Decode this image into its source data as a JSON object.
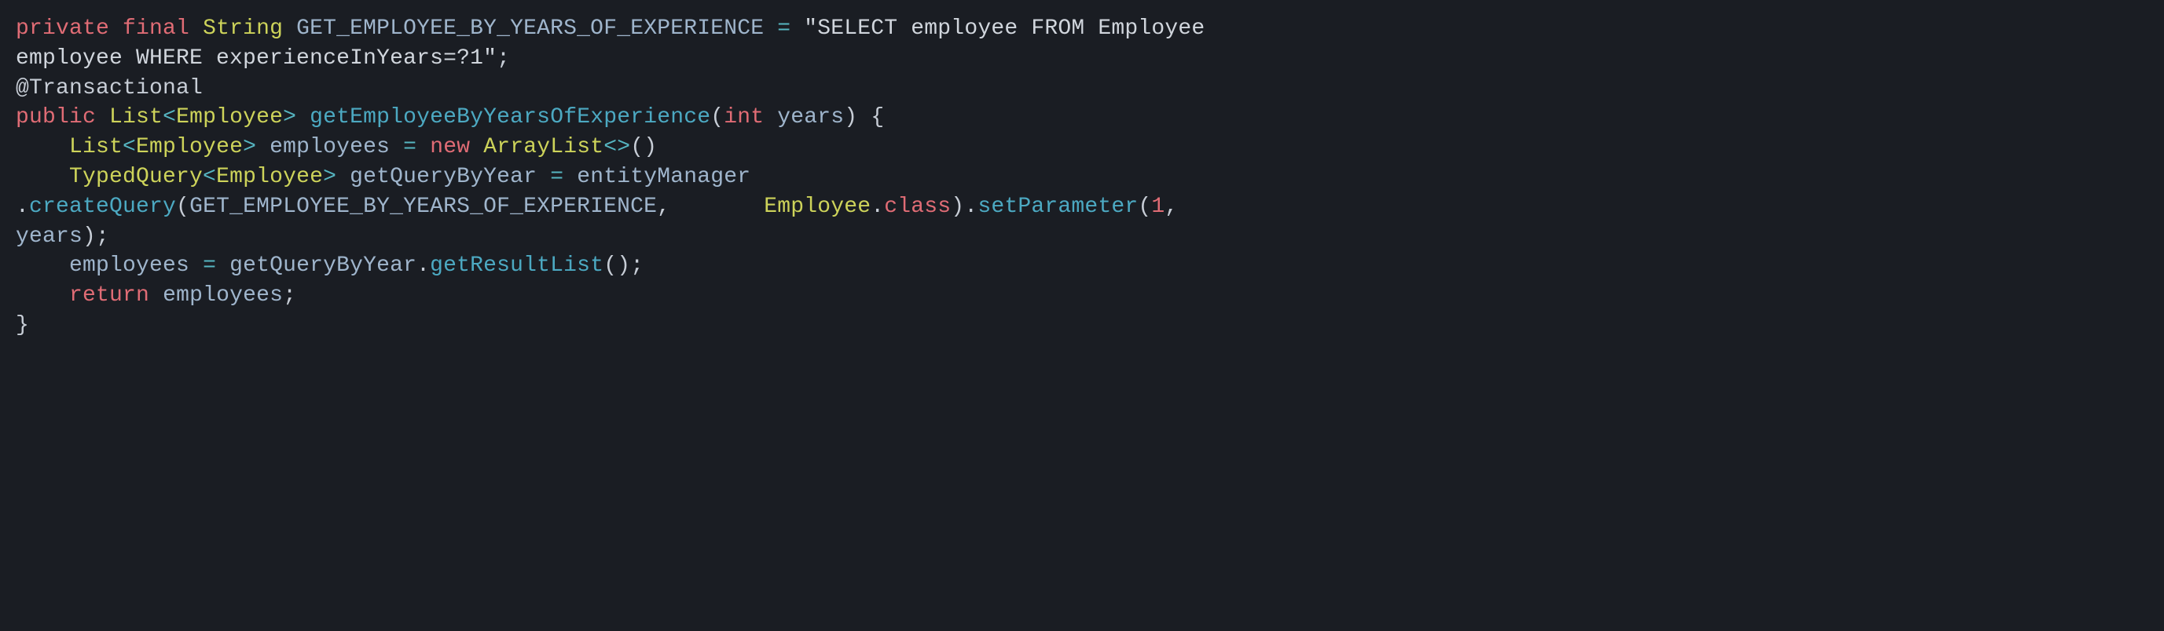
{
  "code": {
    "kw_private": "private",
    "kw_final": "final",
    "kw_public": "public",
    "kw_new": "new",
    "kw_int": "int",
    "kw_return": "return",
    "kw_class": "class",
    "type_String": "String",
    "type_List": "List",
    "type_Employee": "Employee",
    "type_ArrayList": "ArrayList",
    "type_TypedQuery": "TypedQuery",
    "const_name": "GET_EMPLOYEE_BY_YEARS_OF_EXPERIENCE",
    "sql_part1": "\"SELECT employee FROM Employee ",
    "sql_part2": "employee WHERE experienceInYears=?1\"",
    "annotation": "@Transactional",
    "method_name": "getEmployeeByYearsOfExperience",
    "param_name": "years",
    "var_employees": "employees",
    "var_getQueryByYear": "getQueryByYear",
    "var_entityManager": "entityManager",
    "m_createQuery": "createQuery",
    "m_setParameter": "setParameter",
    "m_getResultList": "getResultList",
    "num_1": "1",
    "op_eq": "=",
    "op_lt": "<",
    "op_gt": ">",
    "p_semi": ";",
    "p_dot": ".",
    "p_comma": ",",
    "p_lparen": "(",
    "p_rparen": ")",
    "p_lbrace": "{",
    "p_rbrace": "}",
    "p_diamond": "<>"
  }
}
